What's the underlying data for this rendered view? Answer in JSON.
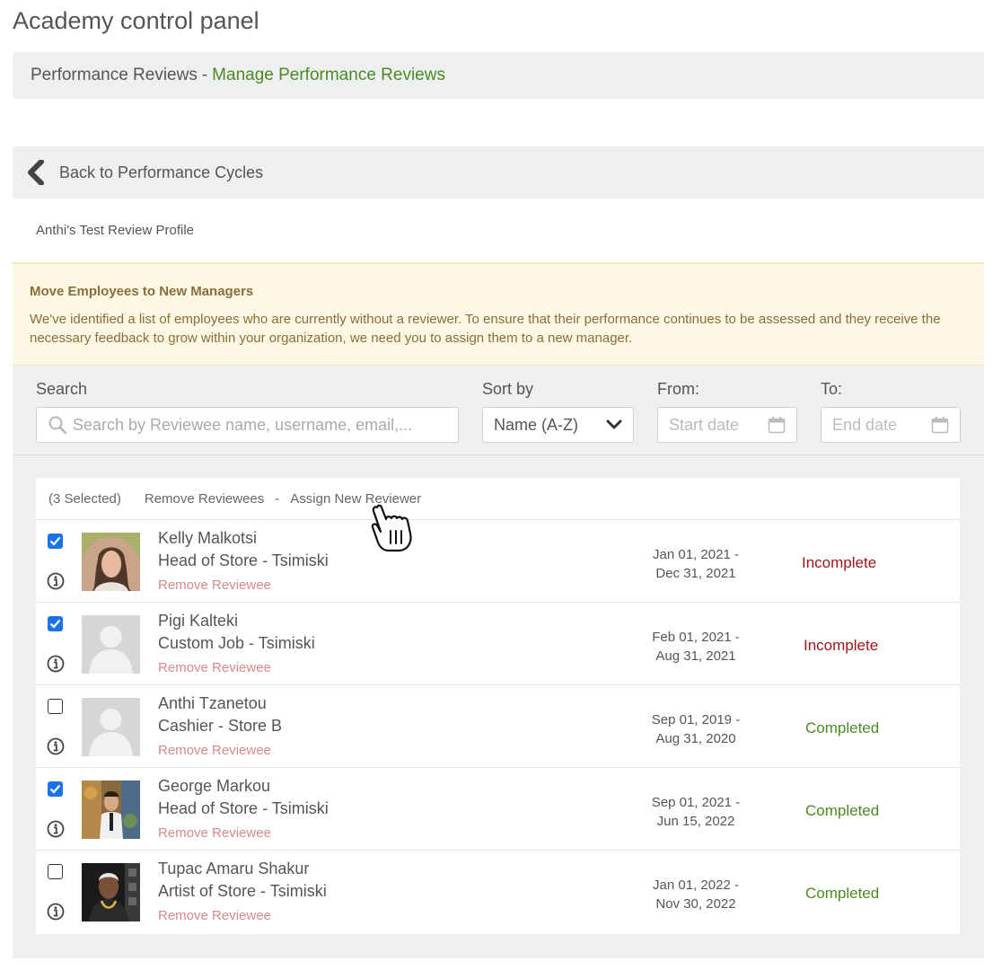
{
  "app": {
    "title": "Academy control panel"
  },
  "breadcrumb": {
    "section": "Performance Reviews",
    "separator": "-",
    "current": "Manage Performance Reviews"
  },
  "back": {
    "label": "Back to Performance Cycles"
  },
  "profile": {
    "name": "Anthi's Test Review Profile"
  },
  "alert": {
    "title": "Move Employees to New Managers",
    "body": "We've identified a list of employees who are currently without a reviewer. To ensure that their performance continues to be assessed and they receive the necessary feedback to grow within your organization, we need you to assign them to a new manager."
  },
  "filters": {
    "search_label": "Search",
    "search_placeholder": "Search by Reviewee name, username, email,...",
    "sort_label": "Sort by",
    "sort_value": "Name (A-Z)",
    "from_label": "From:",
    "from_placeholder": "Start date",
    "to_label": "To:",
    "to_placeholder": "End date"
  },
  "bulk": {
    "selected": "(3 Selected)",
    "remove": "Remove Reviewees",
    "dash": "-",
    "assign": "Assign New Reviewer"
  },
  "rows": [
    {
      "name": "Kelly Malkotsi",
      "job": "Head of Store - Tsimiski",
      "remove": "Remove Reviewee",
      "date_from": "Jan 01, 2021 -",
      "date_to": "Dec 31, 2021",
      "status": "Incomplete",
      "checked": true
    },
    {
      "name": "Pigi Kalteki",
      "job": "Custom Job - Tsimiski",
      "remove": "Remove Reviewee",
      "date_from": "Feb 01, 2021 -",
      "date_to": "Aug 31, 2021",
      "status": "Incomplete",
      "checked": true
    },
    {
      "name": "Anthi Tzanetou",
      "job": "Cashier - Store B",
      "remove": "Remove Reviewee",
      "date_from": "Sep 01, 2019 -",
      "date_to": "Aug 31, 2020",
      "status": "Completed",
      "checked": false
    },
    {
      "name": "George Markou",
      "job": "Head of Store - Tsimiski",
      "remove": "Remove Reviewee",
      "date_from": "Sep 01, 2021 -",
      "date_to": "Jun 15, 2022",
      "status": "Completed",
      "checked": true
    },
    {
      "name": "Tupac Amaru Shakur",
      "job": "Artist of Store - Tsimiski",
      "remove": "Remove Reviewee",
      "date_from": "Jan 01, 2022 -",
      "date_to": "Nov 30, 2022",
      "status": "Completed",
      "checked": false
    }
  ],
  "colors": {
    "accent_green": "#4c8a22",
    "incomplete_red": "#a3141b",
    "checkbox_blue": "#1a73e8",
    "remove_link": "#d98a88",
    "alert_bg": "#fdf8e4",
    "panel_bg": "#eeeff0"
  },
  "icons": {
    "back": "chevron-left-icon",
    "search": "search-icon",
    "sort": "chevron-down-icon",
    "date": "calendar-icon",
    "info": "info-icon",
    "check": "checkmark-icon",
    "cursor": "hand-pointer-icon"
  }
}
